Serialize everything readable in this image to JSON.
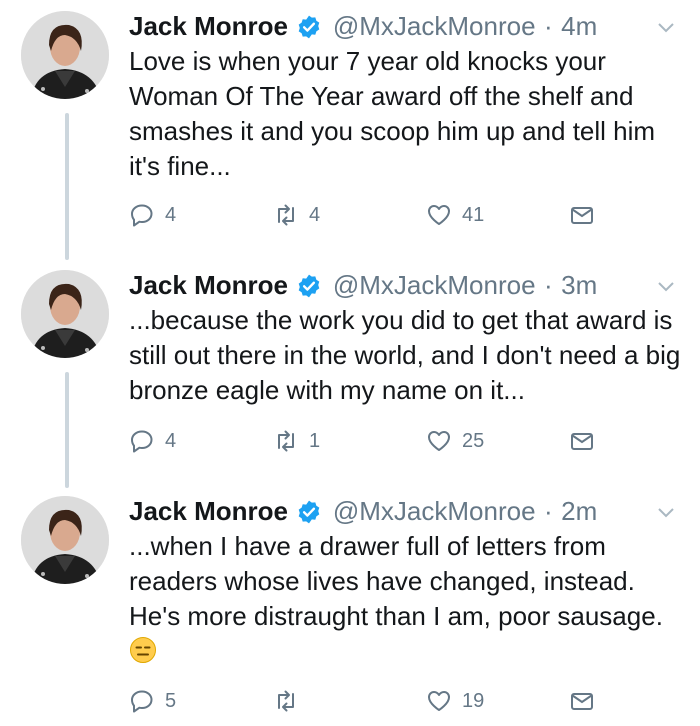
{
  "account": {
    "name": "Jack Monroe",
    "handle": "@MxJackMonroe",
    "verified_color": "#1da1f2"
  },
  "tweets": [
    {
      "time": "4m",
      "text": "Love is when your 7 year old knocks your Woman Of The Year award off the shelf and smashes it and you scoop him up and tell him it's fine...",
      "replies": "4",
      "retweets": "4",
      "likes": "41"
    },
    {
      "time": "3m",
      "text": "...because the work you did to get that award is still out there in the world, and I don't need a big bronze eagle with my name on it...",
      "replies": "4",
      "retweets": "1",
      "likes": "25"
    },
    {
      "time": "2m",
      "text": "...when I have a drawer full of letters from readers whose lives have changed, instead. He's more distraught than I am, poor sausage.",
      "emoji": "expressionless-face-emoji",
      "replies": "5",
      "retweets": "",
      "likes": "19"
    }
  ],
  "separator": "·",
  "icons": {
    "reply": "reply-icon",
    "retweet": "retweet-icon",
    "like": "heart-icon",
    "dm": "envelope-icon",
    "menu": "chevron-down-icon"
  },
  "colors": {
    "muted": "#657786",
    "thread_line": "#ccd6dd",
    "text": "#14171a"
  }
}
